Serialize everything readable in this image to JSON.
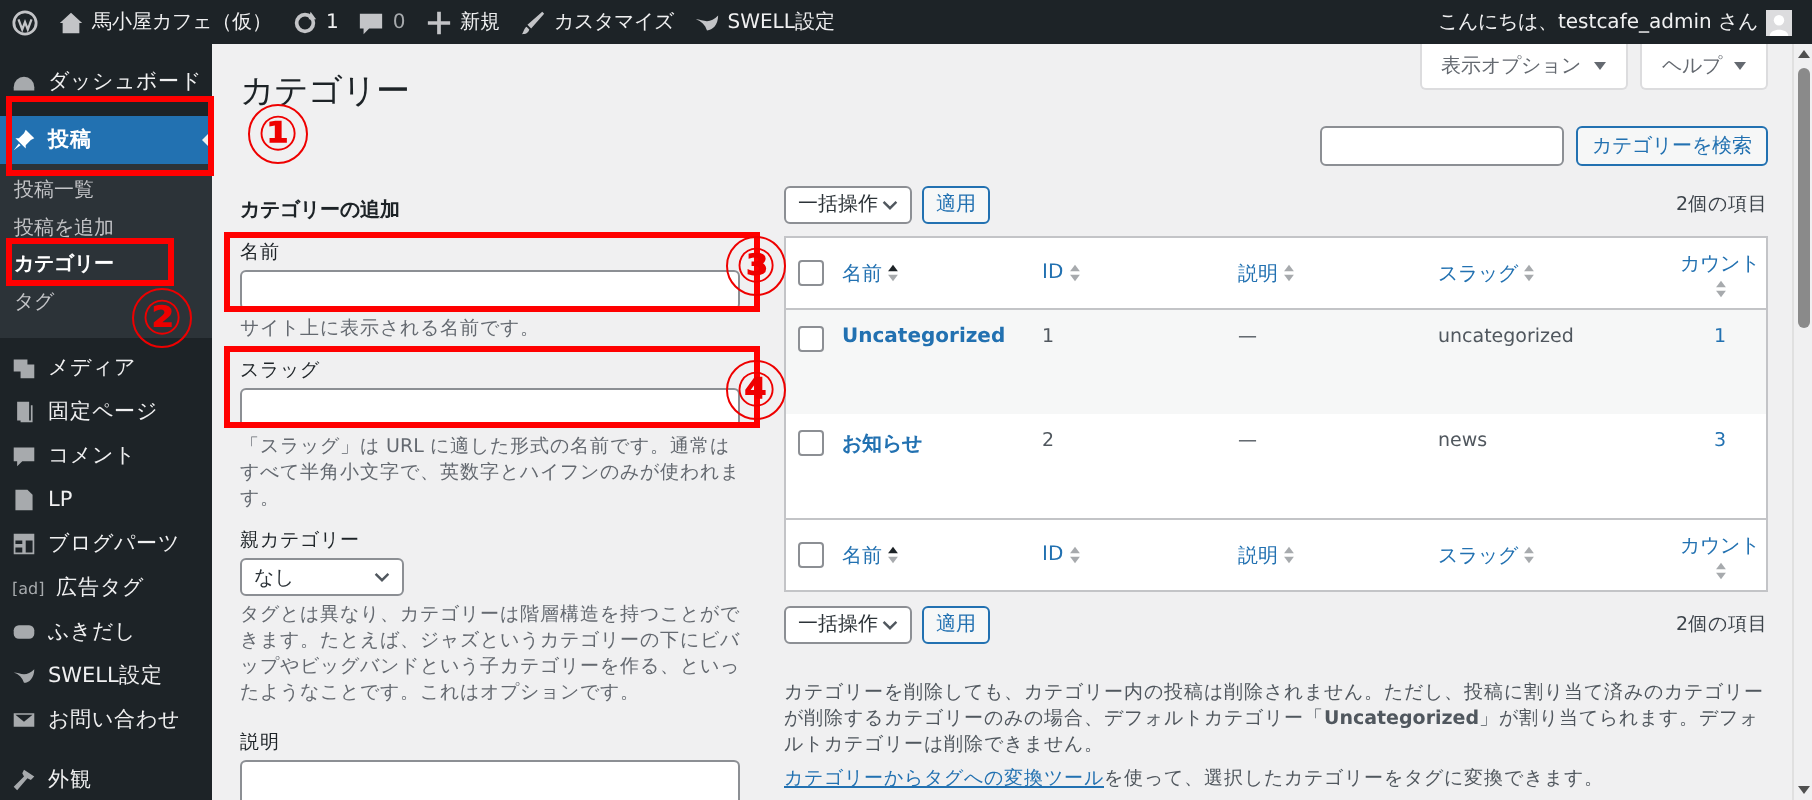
{
  "admin_bar": {
    "site": "馬小屋カフェ（仮）",
    "updates": "1",
    "comments": "0",
    "new": "新規",
    "customize": "カスタマイズ",
    "swell": "SWELL設定",
    "greeting": "こんにちは、testcafe_admin さん"
  },
  "sidebar": {
    "items": [
      {
        "label": "ダッシュボード",
        "selected": false
      },
      {
        "label": "投稿",
        "selected": true,
        "children": [
          {
            "label": "投稿一覧",
            "selected": false
          },
          {
            "label": "投稿を追加",
            "selected": false
          },
          {
            "label": "カテゴリー",
            "selected": true
          },
          {
            "label": "タグ",
            "selected": false
          }
        ]
      },
      {
        "label": "メディア",
        "selected": false
      },
      {
        "label": "固定ページ",
        "selected": false
      },
      {
        "label": "コメント",
        "selected": false
      },
      {
        "label": "LP",
        "selected": false
      },
      {
        "label": "ブログパーツ",
        "selected": false
      },
      {
        "label": "広告タグ",
        "icon_text": "[ad]",
        "selected": false
      },
      {
        "label": "ふきだし",
        "selected": false
      },
      {
        "label": "SWELL設定",
        "selected": false
      },
      {
        "label": "お問い合わせ",
        "selected": false
      },
      {
        "label": "外観",
        "selected": false
      }
    ]
  },
  "screen_options": "表示オプション",
  "help": "ヘルプ",
  "page_title": "カテゴリー",
  "add_form": {
    "heading": "カテゴリーの追加",
    "name_label": "名前",
    "name_hint": "サイト上に表示される名前です。",
    "slug_label": "スラッグ",
    "slug_hint": "「スラッグ」は URL に適した形式の名前です。通常はすべて半角小文字で、英数字とハイフンのみが使われます。",
    "parent_label": "親カテゴリー",
    "parent_value": "なし",
    "parent_hint": "タグとは異なり、カテゴリーは階層構造を持つことができます。たとえば、ジャズというカテゴリーの下にビバップやビッグバンドという子カテゴリーを作る、といったようなことです。これはオプションです。",
    "description_label": "説明"
  },
  "search": {
    "button": "カテゴリーを検索"
  },
  "bulk_top": {
    "action": "一括操作",
    "apply": "適用",
    "count": "2個の項目"
  },
  "table": {
    "header_checked": false,
    "footer_checked": false,
    "columns": [
      {
        "label": "名前",
        "sorted": true
      },
      {
        "label": "ID",
        "sorted": false
      },
      {
        "label": "説明",
        "sorted": false
      },
      {
        "label": "スラッグ",
        "sorted": false
      },
      {
        "label": "カウント",
        "sorted": false
      }
    ],
    "rows": [
      {
        "checked": false,
        "name": "Uncategorized",
        "id": "1",
        "description": "—",
        "slug": "uncategorized",
        "count": "1"
      },
      {
        "checked": false,
        "name": "お知らせ",
        "id": "2",
        "description": "—",
        "slug": "news",
        "count": "3"
      }
    ],
    "footer_columns": [
      {
        "label": "名前",
        "sorted": true
      },
      {
        "label": "ID",
        "sorted": false
      },
      {
        "label": "説明",
        "sorted": false
      },
      {
        "label": "スラッグ",
        "sorted": false
      },
      {
        "label": "カウント",
        "sorted": false
      }
    ]
  },
  "bulk_bottom": {
    "action": "一括操作",
    "apply": "適用",
    "count": "2個の項目"
  },
  "footer_note": "カテゴリーを削除しても、カテゴリー内の投稿は削除されません。ただし、投稿に割り当て済みのカテゴリーが削除するカテゴリーのみの場合、デフォルトカテゴリー「**Uncategorized**」が割り当てられます。デフォルトカテゴリーは削除できません。",
  "convert": {
    "link": "カテゴリーからタグへの変換ツール",
    "rest": "を使って、選択したカテゴリーをタグに変換できます。"
  },
  "annotations": [
    {
      "label": "①"
    },
    {
      "label": "②"
    },
    {
      "label": "③"
    },
    {
      "label": "④"
    }
  ]
}
